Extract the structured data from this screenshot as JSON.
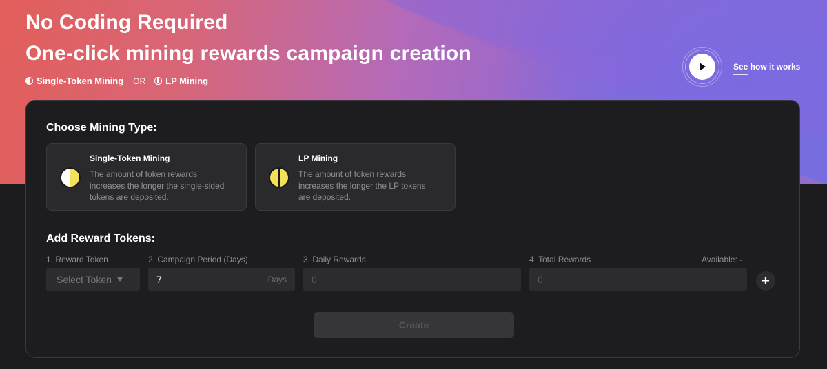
{
  "hero": {
    "title": "No Coding Required",
    "subtitle": "One-click mining rewards campaign creation",
    "tags": {
      "single": "Single-Token Mining",
      "or": "OR",
      "lp": "LP Mining"
    },
    "see_how": "See how it works"
  },
  "choose_type": {
    "title": "Choose Mining Type:",
    "options": [
      {
        "name": "Single-Token Mining",
        "desc": "The amount of token rewards increases the longer the single-sided tokens are deposited."
      },
      {
        "name": "LP Mining",
        "desc": "The amount of token rewards increases the longer the LP tokens are deposited."
      }
    ]
  },
  "rewards": {
    "title": "Add Reward Tokens:",
    "labels": {
      "token": "1. Reward Token",
      "period": "2. Campaign Period (Days)",
      "daily": "3. Daily Rewards",
      "total": "4. Total Rewards",
      "available": "Available: -"
    },
    "token_placeholder": "Select Token",
    "period_value": "7",
    "period_unit": "Days",
    "daily_placeholder": "0",
    "total_placeholder": "0",
    "add_symbol": "+"
  },
  "create_label": "Create",
  "colors": {
    "accent_yellow": "#f4e05a",
    "card_bg": "#1d1d1f",
    "field_bg": "#2c2c2e"
  }
}
